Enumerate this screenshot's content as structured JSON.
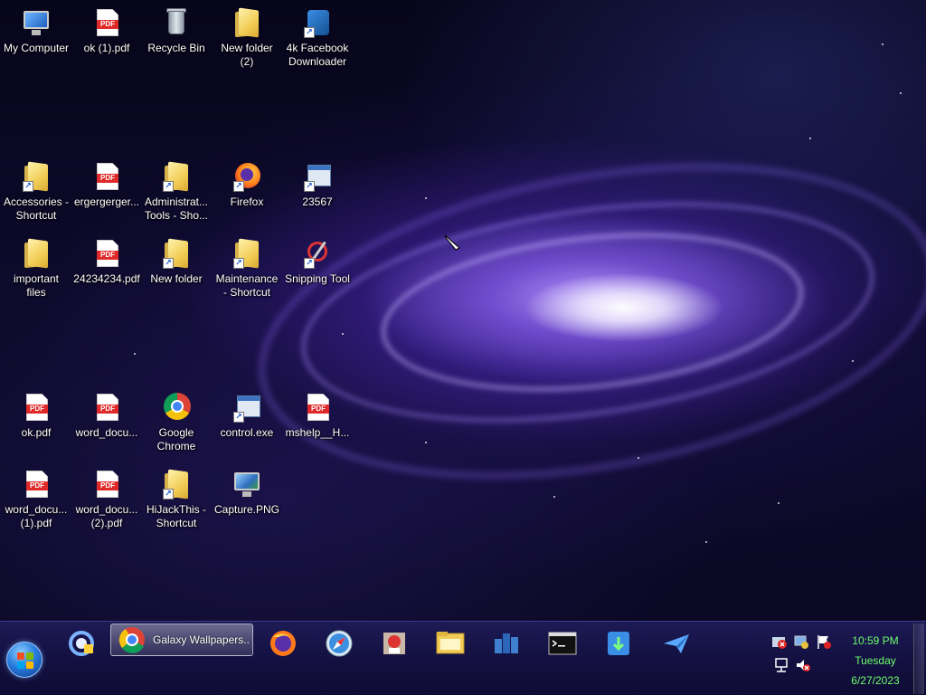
{
  "desktop": {
    "icons": [
      {
        "line1": "My Computer",
        "line2": ""
      },
      {
        "line1": "ok (1).pdf",
        "line2": ""
      },
      {
        "line1": "Recycle Bin",
        "line2": ""
      },
      {
        "line1": "New folder",
        "line2": "(2)"
      },
      {
        "line1": "4k Facebook",
        "line2": "Downloader"
      },
      {
        "line1": "Accessories -",
        "line2": "Shortcut"
      },
      {
        "line1": "ergergerger...",
        "line2": ""
      },
      {
        "line1": "Administrat...",
        "line2": "Tools - Sho..."
      },
      {
        "line1": "Firefox",
        "line2": ""
      },
      {
        "line1": "23567",
        "line2": ""
      },
      {
        "line1": "important",
        "line2": "files"
      },
      {
        "line1": "24234234.pdf",
        "line2": ""
      },
      {
        "line1": "New folder",
        "line2": ""
      },
      {
        "line1": "Maintenance",
        "line2": "- Shortcut"
      },
      {
        "line1": "Snipping Tool",
        "line2": ""
      },
      {
        "line1": "ok.pdf",
        "line2": ""
      },
      {
        "line1": "word_docu...",
        "line2": ""
      },
      {
        "line1": "Google",
        "line2": "Chrome"
      },
      {
        "line1": "control.exe",
        "line2": ""
      },
      {
        "line1": "mshelp__H...",
        "line2": ""
      },
      {
        "line1": "word_docu...",
        "line2": "(1).pdf"
      },
      {
        "line1": "word_docu...",
        "line2": "(2).pdf"
      },
      {
        "line1": "HiJackThis -",
        "line2": "Shortcut"
      },
      {
        "line1": "Capture.PNG",
        "line2": ""
      }
    ],
    "icon_kinds": [
      "computer-icon",
      "pdf-icon",
      "recycle-bin-icon",
      "folder-icon",
      "app-download-icon",
      "folder-shortcut-icon",
      "pdf-icon",
      "folder-shortcut-icon",
      "firefox-icon",
      "app-window-icon",
      "folder-icon",
      "pdf-icon",
      "folder-icon",
      "folder-shortcut-icon",
      "snipping-tool-icon",
      "pdf-icon",
      "pdf-icon",
      "chrome-icon",
      "control-panel-icon",
      "pdf-icon",
      "pdf-icon",
      "pdf-icon",
      "folder-shortcut-icon",
      "image-file-icon"
    ]
  },
  "taskbar": {
    "active_window_label": "Galaxy Wallpapers...",
    "pinned_icons": [
      "sync-icon",
      "chrome-icon",
      "firefox-icon",
      "safari-icon",
      "shield-app-icon",
      "file-explorer-icon",
      "network-tool-icon",
      "command-prompt-icon",
      "download-app-icon",
      "send-icon"
    ],
    "tray_icons": [
      "error-icon",
      "network-settings-icon",
      "action-center-flag-icon",
      "network-icon",
      "volume-muted-icon"
    ],
    "clock": {
      "time": "10:59 PM",
      "day": "Tuesday",
      "date": "6/27/2023"
    },
    "clock_color": "#6cff6c"
  },
  "colors": {
    "taskbar_bg": "#151245",
    "pdf_red": "#e02a2a",
    "folder_yellow": "#f2cd55"
  }
}
